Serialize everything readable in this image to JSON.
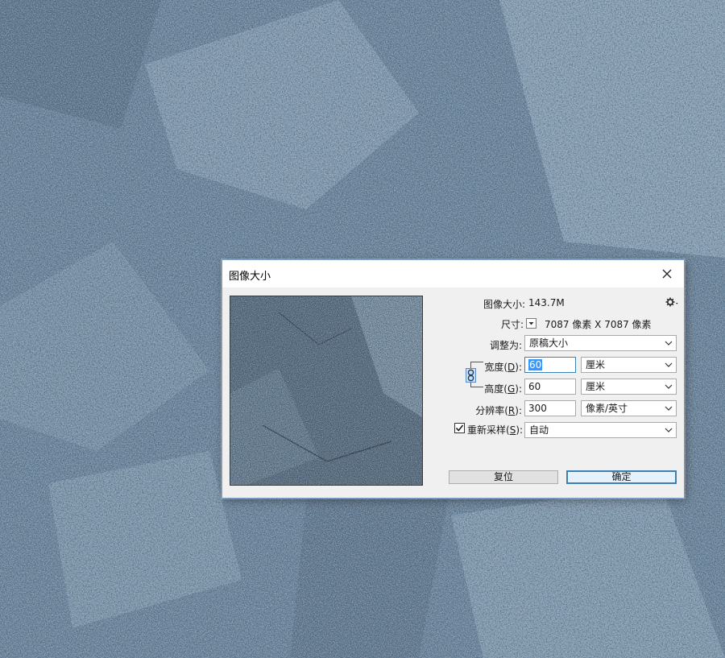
{
  "dialog": {
    "title": "图像大小",
    "image_size_label": "图像大小:",
    "image_size_value": "143.7M",
    "dimensions_label": "尺寸:",
    "dimensions_value": "7087 像素  X  7087 像素",
    "fit_to_label": "调整为:",
    "fit_to_value": "原稿大小",
    "width_label_pre": "宽度(",
    "width_label_key": "D",
    "width_label_post": "):",
    "width_value": "60",
    "width_unit": "厘米",
    "height_label_pre": "高度(",
    "height_label_key": "G",
    "height_label_post": "):",
    "height_value": "60",
    "height_unit": "厘米",
    "resolution_label_pre": "分辨率(",
    "resolution_label_key": "R",
    "resolution_label_post": "):",
    "resolution_value": "300",
    "resolution_unit": "像素/英寸",
    "resample_label_pre": "重新采样(",
    "resample_label_key": "S",
    "resample_label_post": "):",
    "resample_checked": true,
    "resample_value": "自动",
    "reset_button": "复位",
    "ok_button": "确定"
  },
  "icons": {
    "close": "close-icon",
    "gear": "gear-icon",
    "chain": "chain-link-icon",
    "dropdown": "chevron-down-icon",
    "check": "checkmark-icon"
  },
  "colors": {
    "texture_base": "#5f7a93",
    "texture_light": "#c9d6e2",
    "texture_dark": "#1e2a36",
    "focus_border": "#3c7fb1",
    "selection": "#3399ff"
  }
}
